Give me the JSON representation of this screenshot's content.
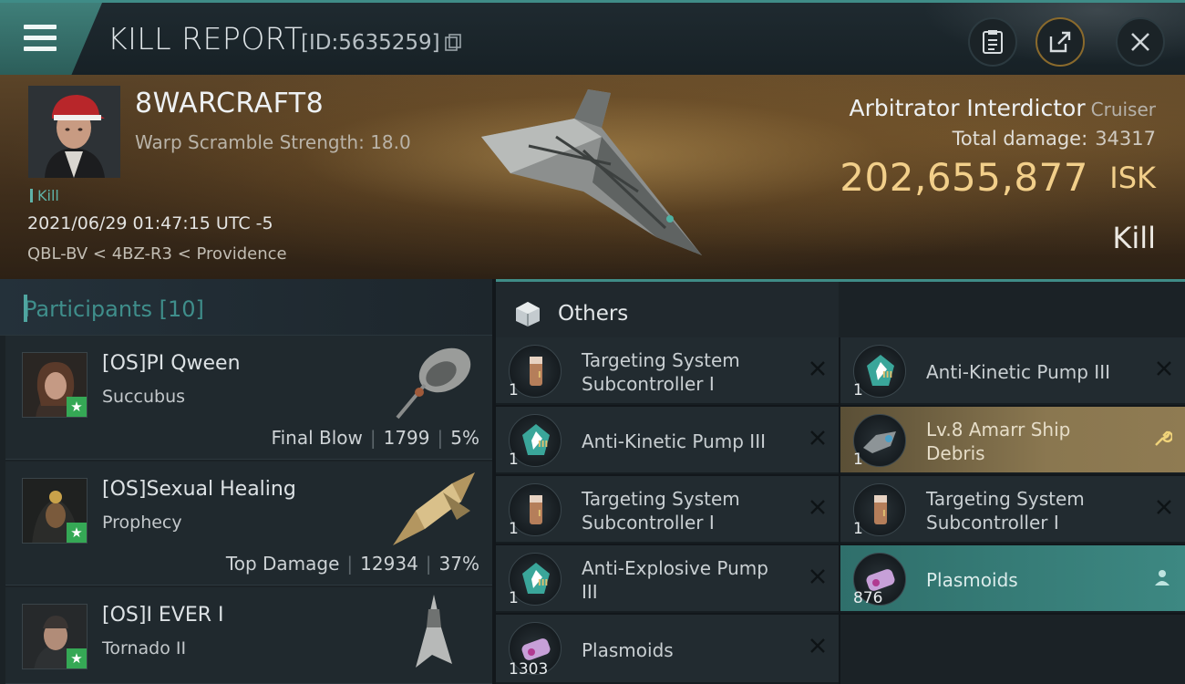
{
  "header": {
    "title": "KILL REPORT",
    "report_id": "[ID:5635259]"
  },
  "victim": {
    "name": "8WARCRAFT8",
    "warp_scramble": "Warp Scramble Strength: 18.0",
    "tag": "Kill",
    "datetime": "2021/06/29 01:47:15 UTC -5",
    "location": "QBL-BV < 4BZ-R3 < Providence",
    "ship_name": "Arbitrator Interdictor",
    "ship_class": "Cruiser",
    "total_damage_label": "Total damage:",
    "total_damage": "34317",
    "isk_value": "202,655,877",
    "isk_unit": "ISK",
    "result": "Kill"
  },
  "participants": {
    "title": "Participants [10]",
    "rows": [
      {
        "name": "[OS]PI Qween",
        "ship": "Succubus",
        "stat_label": "Final Blow",
        "damage": "1799",
        "percent": "5%"
      },
      {
        "name": "[OS]Sexual Healing",
        "ship": "Prophecy",
        "stat_label": "Top Damage",
        "damage": "12934",
        "percent": "37%"
      },
      {
        "name": "[OS]I EVER I",
        "ship": "Tornado II",
        "stat_label": "",
        "damage": "",
        "percent": ""
      }
    ]
  },
  "others": {
    "title": "Others",
    "col1": [
      {
        "qty": "1",
        "name1": "Targeting System",
        "name2": "Subcontroller I",
        "icon": "canister-icon",
        "tier": "I"
      },
      {
        "qty": "1",
        "name1": "Anti-Kinetic Pump III",
        "name2": "",
        "icon": "rig-icon",
        "tier": "III"
      },
      {
        "qty": "1",
        "name1": "Targeting System",
        "name2": "Subcontroller I",
        "icon": "canister-icon",
        "tier": "I"
      },
      {
        "qty": "1",
        "name1": "Anti-Explosive Pump",
        "name2": "III",
        "icon": "rig-icon",
        "tier": "III"
      },
      {
        "qty": "1303",
        "name1": "Plasmoids",
        "name2": "",
        "icon": "plasmoid-icon",
        "tier": ""
      }
    ],
    "col2": [
      {
        "qty": "1",
        "name1": "Anti-Kinetic Pump III",
        "name2": "",
        "icon": "rig-icon",
        "tier": "III",
        "style": "normal"
      },
      {
        "qty": "1",
        "name1": "Lv.8 Amarr Ship",
        "name2": "Debris",
        "icon": "debris-icon",
        "tier": "",
        "style": "gold"
      },
      {
        "qty": "1",
        "name1": "Targeting System",
        "name2": "Subcontroller I",
        "icon": "canister-icon",
        "tier": "I",
        "style": "normal"
      },
      {
        "qty": "876",
        "name1": "Plasmoids",
        "name2": "",
        "icon": "plasmoid-icon",
        "tier": "",
        "style": "teal"
      }
    ]
  },
  "colors": {
    "accent_teal": "#3f8c87",
    "isk_gold": "#f2cf8a",
    "star_green": "#35a855"
  }
}
